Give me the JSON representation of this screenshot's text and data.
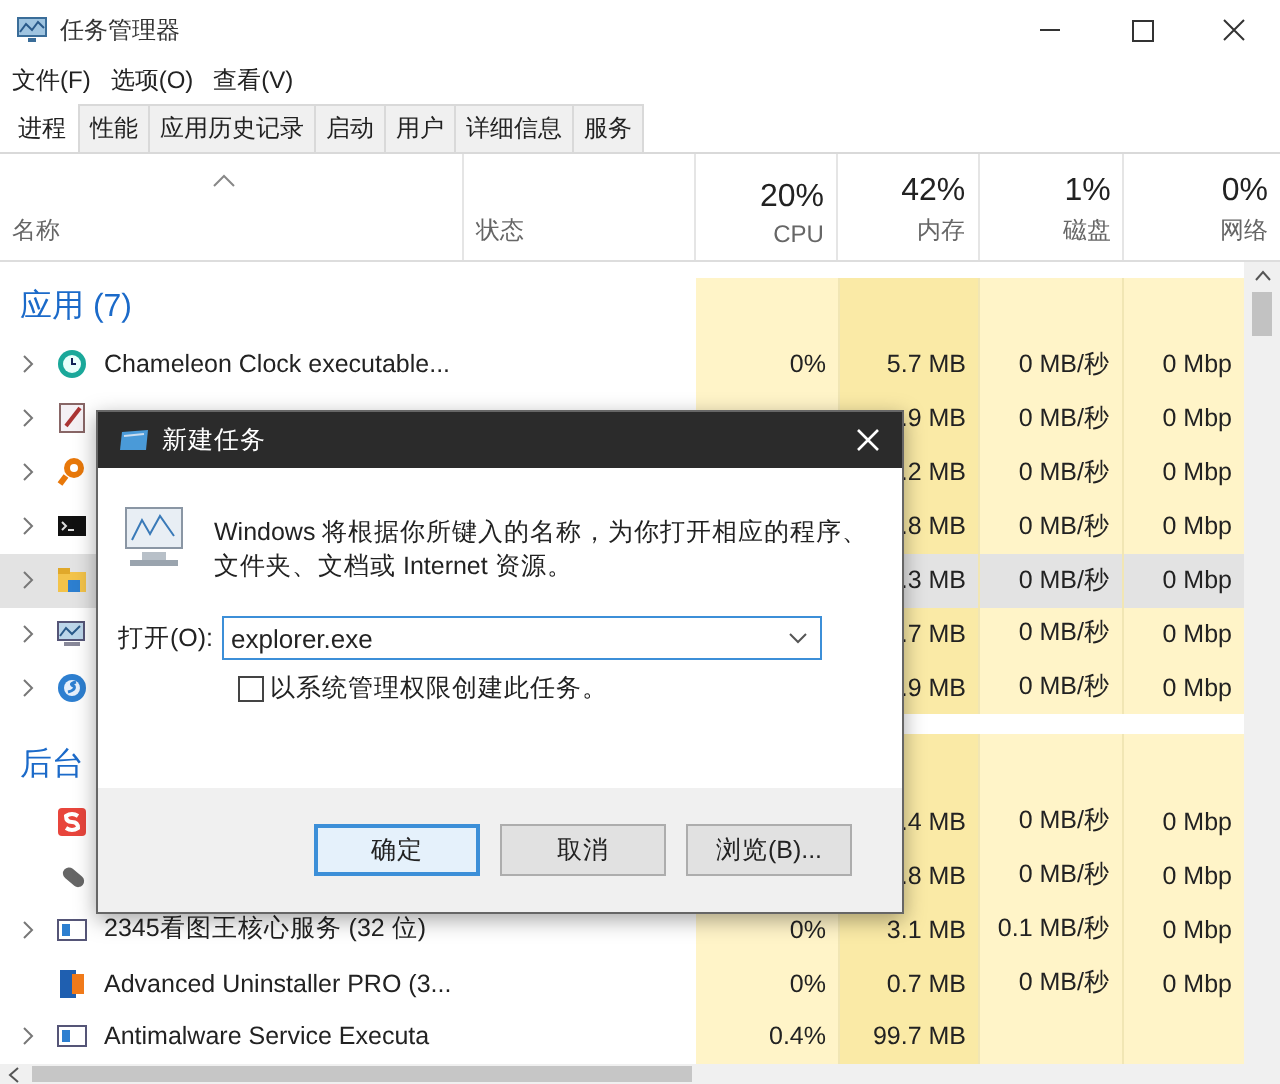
{
  "window": {
    "title": "任务管理器"
  },
  "menu": [
    "文件(F)",
    "选项(O)",
    "查看(V)"
  ],
  "tabs": [
    {
      "label": "进程",
      "selected": true
    },
    {
      "label": "性能",
      "selected": false
    },
    {
      "label": "应用历史记录",
      "selected": false
    },
    {
      "label": "启动",
      "selected": false
    },
    {
      "label": "用户",
      "selected": false
    },
    {
      "label": "详细信息",
      "selected": false
    },
    {
      "label": "服务",
      "selected": false
    }
  ],
  "columns": [
    {
      "label": "名称",
      "sorted": true
    },
    {
      "label": "状态",
      "sorted": false
    },
    {
      "percent": "20%",
      "label": "CPU",
      "sorted": false
    },
    {
      "percent": "42%",
      "label": "内存",
      "sorted": false
    },
    {
      "percent": "1%",
      "label": "磁盘",
      "sorted": false
    },
    {
      "percent": "0%",
      "label": "网络",
      "sorted": false
    }
  ],
  "groups": [
    {
      "title": "应用 (7)",
      "rows": [
        {
          "expandable": true,
          "selected": false,
          "name": "Chameleon Clock executable...",
          "cpu": "0%",
          "memory": "5.7 MB",
          "disk": "0 MB/秒",
          "network": "0 Mbp"
        },
        {
          "expandable": true,
          "selected": false,
          "memory": ".9 MB",
          "disk": "0 MB/秒",
          "network": "0 Mbp"
        },
        {
          "expandable": true,
          "selected": false,
          "memory": ".2 MB",
          "disk": "0 MB/秒",
          "network": "0 Mbp"
        },
        {
          "expandable": true,
          "selected": false,
          "memory": ".8 MB",
          "disk": "0 MB/秒",
          "network": "0 Mbp"
        },
        {
          "expandable": true,
          "selected": true,
          "memory": ".3 MB",
          "disk": "0 MB/秒",
          "network": "0 Mbp"
        },
        {
          "expandable": true,
          "selected": false,
          "memory": ".7 MB",
          "disk": "0 MB/秒",
          "network": "0 Mbp"
        },
        {
          "expandable": true,
          "selected": false,
          "memory": ".9 MB",
          "disk": "0 MB/秒",
          "network": "0 Mbp"
        }
      ]
    },
    {
      "title": "后台",
      "rows": [
        {
          "expandable": false,
          "selected": false,
          "memory": ".4 MB",
          "disk": "0 MB/秒",
          "network": "0 Mbp"
        },
        {
          "expandable": false,
          "selected": false,
          "memory": ".8 MB",
          "disk": "0 MB/秒",
          "network": "0 Mbp"
        },
        {
          "expandable": true,
          "selected": false,
          "name": "2345看图王核心服务 (32 位)",
          "cpu": "0%",
          "memory": "3.1 MB",
          "disk": "0.1 MB/秒",
          "network": "0 Mbp"
        },
        {
          "expandable": false,
          "selected": false,
          "name": "Advanced Uninstaller PRO (3...",
          "cpu": "0%",
          "memory": "0.7 MB",
          "disk": "0 MB/秒",
          "network": "0 Mbp"
        },
        {
          "expandable": true,
          "selected": false,
          "name": "Antimalware Service Executa",
          "cpu": "0.4%",
          "memory": "99.7 MB"
        }
      ]
    }
  ],
  "dialog": {
    "title": "新建任务",
    "message_lines": [
      "Windows 将根据你所键入的名称，为你打开相应的程序、",
      "文件夹、文档或 Internet 资源。"
    ],
    "open_label": "打开(O):",
    "value": "explorer.exe",
    "checkbox": {
      "label": "以系统管理权限创建此任务。",
      "checked": false
    },
    "buttons": [
      {
        "label": "确定",
        "default": true
      },
      {
        "label": "取消",
        "default": false
      },
      {
        "label": "浏览(B)...",
        "default": false
      }
    ]
  }
}
